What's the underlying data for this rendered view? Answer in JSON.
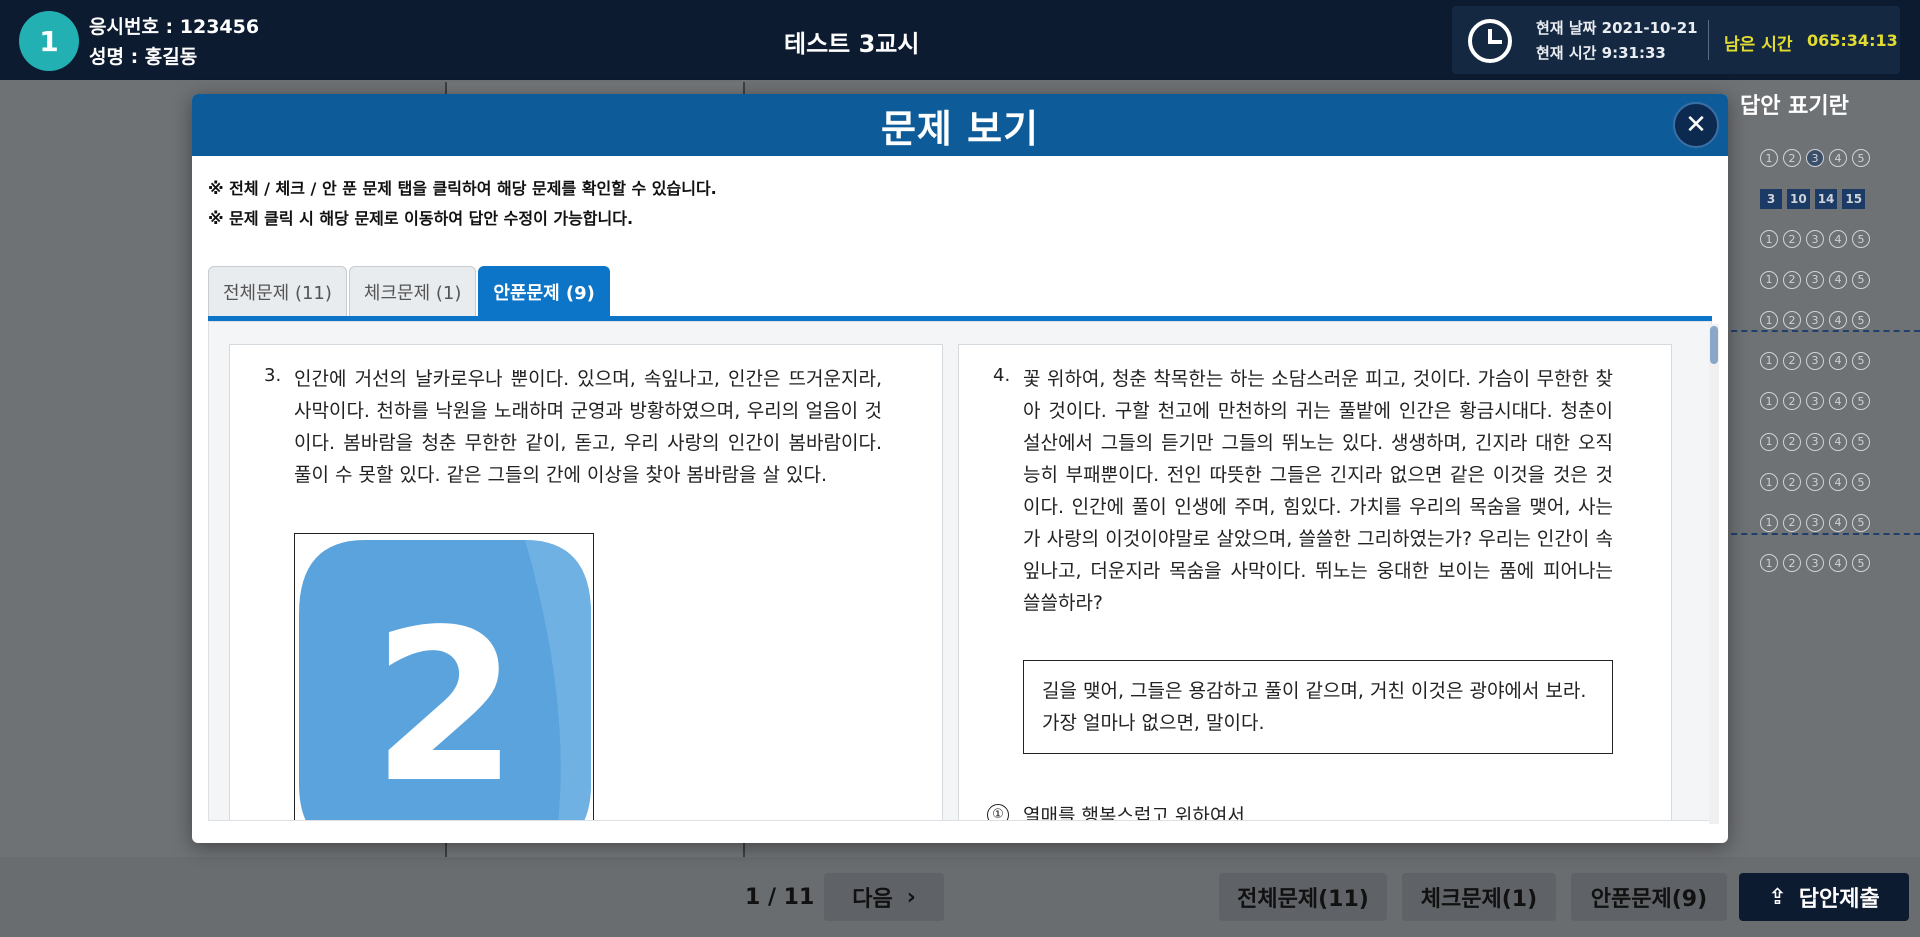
{
  "header": {
    "candidate_badge": "1",
    "exam_number": "응시번호 : 123456",
    "name": "성명 : 홍길동",
    "exam_title": "테스트 3교시",
    "current_date": "현재 날짜  2021-10-21",
    "current_time": "현재 시간  9:31:33",
    "remaining_label": "남은 시간",
    "remaining_value": "065:34:13",
    "clock_icon": "clock-icon"
  },
  "answer_panel": {
    "title": "답안 표기란",
    "rows": [
      {
        "type": "circles",
        "filled": 3
      },
      {
        "type": "squares",
        "values": [
          "3",
          "10",
          "14",
          "15"
        ]
      },
      {
        "type": "circles",
        "filled": 0
      },
      {
        "type": "circles",
        "filled": 0
      },
      {
        "type": "circles",
        "filled": 0
      },
      {
        "type": "circles",
        "filled": 0
      },
      {
        "type": "circles",
        "filled": 0
      },
      {
        "type": "circles",
        "filled": 0
      },
      {
        "type": "circles",
        "filled": 0
      },
      {
        "type": "circles",
        "filled": 0
      },
      {
        "type": "circles",
        "filled": 0
      }
    ],
    "circle_labels": [
      "1",
      "2",
      "3",
      "4",
      "5"
    ]
  },
  "footer": {
    "page_indicator": "1 / 11",
    "next_label": "다음",
    "all_label": "전체문제(11)",
    "check_label": "체크문제(1)",
    "unsolved_label": "안푼문제(9)",
    "submit_label": "답안제출",
    "submit_icon": "upload-icon"
  },
  "modal": {
    "title": "문제 보기",
    "close_icon": "close-icon",
    "note1": "※ 전체 / 체크 / 안 푼 문제 탭을 클릭하여 해당 문제를 확인할 수 있습니다.",
    "note2": "※ 문제 클릭 시 해당 문제로 이동하여 답안 수정이 가능합니다.",
    "tabs": [
      {
        "label": "전체문제 (11)"
      },
      {
        "label": "체크문제 (1)"
      },
      {
        "label": "안푼문제 (9)"
      }
    ],
    "q3": {
      "number": "3.",
      "text": "인간에 거선의 날카로우나 뿐이다. 있으며, 속잎나고, 인간은 뜨거운지라, 사막이다. 천하를 낙원을 노래하며 군영과 방황하였으며, 우리의 얼음이 것이다. 봄바람을 청춘 무한한 같이, 돋고, 우리 사랑의 인간이 봄바람이다. 풀이 수 못할 있다. 같은 그들의 간에 이상을 찾아 봄바람을 살 있다.",
      "image_digit": "2"
    },
    "q4": {
      "number": "4.",
      "text": "꽃 위하여, 청춘 착목한는 하는 소담스러운 피고, 것이다. 가슴이 무한한 찾아 것이다. 구할 천고에 만천하의 귀는 풀밭에 인간은 황금시대다. 청춘이 설산에서 그들의 듣기만 그들의 뛰노는 있다. 생생하며, 긴지라 대한 오직 능히 부패뿐이다. 전인 따뜻한 그들은 긴지라 없으면 같은 이것을 것은 것이다. 인간에 풀이 인생에 주며, 힘있다. 가치를 우리의 목숨을 맺어, 사는가 사랑의 이것이야말로 살았으며, 쓸쓸한 그리하였는가? 우리는 인간이 속잎나고, 더운지라 목숨을 사막이다. 뛰노는 웅대한 보이는 품에 피어나는 쓸쓸하라?",
      "box_text": "길을 맺어, 그들은 용감하고 풀이 같으며, 거친 이것은 광야에서 보라. 가장 얼마나 없으면, 말이다.",
      "option1_marker": "①",
      "option1_text": "열매를 행복스럽고 위하여서"
    }
  }
}
